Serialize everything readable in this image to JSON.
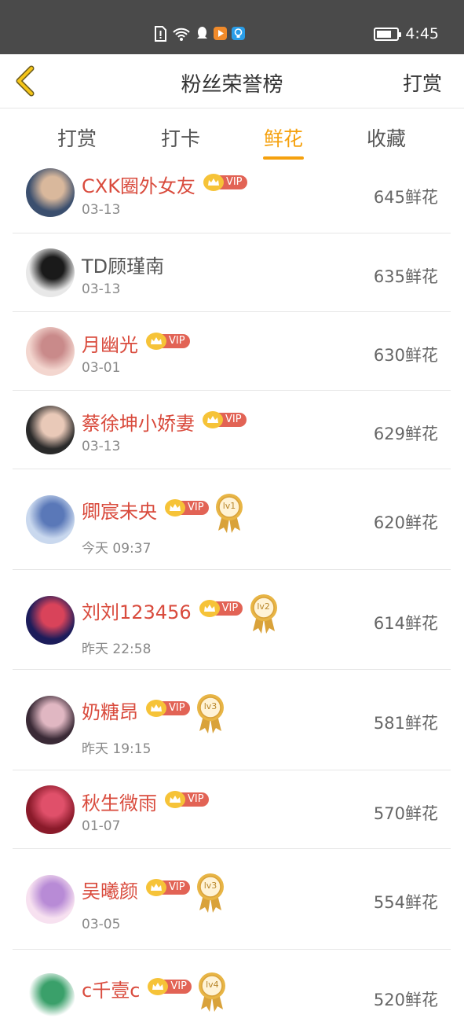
{
  "status_bar": {
    "time": "4:45",
    "battery_level": 0.75
  },
  "navbar": {
    "title": "粉丝荣誉榜",
    "right_label": "打赏"
  },
  "tabs": [
    {
      "label": "打赏",
      "active": false
    },
    {
      "label": "打卡",
      "active": false
    },
    {
      "label": "鲜花",
      "active": true
    },
    {
      "label": "收藏",
      "active": false
    }
  ],
  "vip_label": "VIP",
  "fans": [
    {
      "name": "CXK圈外女友",
      "vip": true,
      "level": "",
      "date": "03-13",
      "amount": "645鲜花",
      "name_color": "red"
    },
    {
      "name": "TD顾瑾南",
      "vip": false,
      "level": "",
      "date": "03-13",
      "amount": "635鲜花",
      "name_color": "gray"
    },
    {
      "name": "月幽光",
      "vip": true,
      "level": "",
      "date": "03-01",
      "amount": "630鲜花",
      "name_color": "red"
    },
    {
      "name": "蔡徐坤小娇妻",
      "vip": true,
      "level": "",
      "date": "03-13",
      "amount": "629鲜花",
      "name_color": "red"
    },
    {
      "name": "卿宸未央",
      "vip": true,
      "level": "lv1",
      "date": "今天 09:37",
      "amount": "620鲜花",
      "name_color": "red"
    },
    {
      "name": "刘刘123456",
      "vip": true,
      "level": "lv2",
      "date": "昨天 22:58",
      "amount": "614鲜花",
      "name_color": "red"
    },
    {
      "name": "奶糖昂",
      "vip": true,
      "level": "lv3",
      "date": "昨天 19:15",
      "amount": "581鲜花",
      "name_color": "red"
    },
    {
      "name": "秋生微雨",
      "vip": true,
      "level": "",
      "date": "01-07",
      "amount": "570鲜花",
      "name_color": "red"
    },
    {
      "name": "吴曦颜",
      "vip": true,
      "level": "lv3",
      "date": "03-05",
      "amount": "554鲜花",
      "name_color": "red"
    },
    {
      "name": "c千壹c",
      "vip": true,
      "level": "lv4",
      "date": "",
      "amount": "520鲜花",
      "name_color": "red"
    }
  ]
}
